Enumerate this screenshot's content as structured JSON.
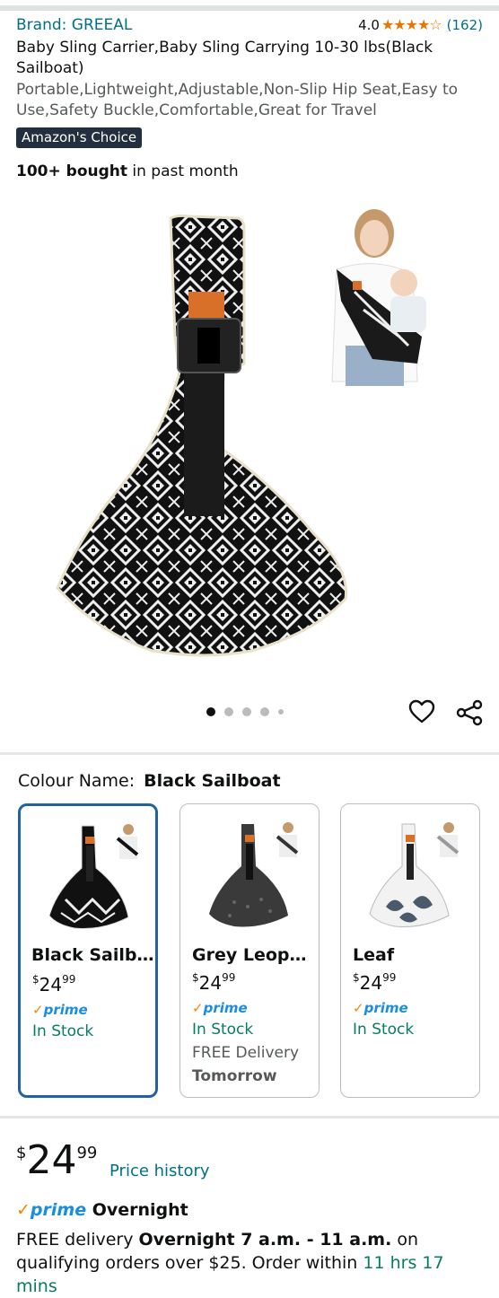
{
  "header": {
    "brand": "Brand: GREEAL",
    "rating_value": "4.0",
    "rating_stars": "★★★★☆",
    "rating_count": "(162)",
    "title": "Baby Sling Carrier,Baby Sling Carrying 10-30 lbs(Black Sailboat)",
    "subtitle": "Portable,Lightweight,Adjustable,Non-Slip Hip Seat,Easy to Use,Safety Buckle,Comfortable,Great for Travel",
    "badge": "Amazon's Choice",
    "bought_bold": "100+ bought",
    "bought_rest": " in past month"
  },
  "gallery": {
    "image_count": 5,
    "active_index": 0
  },
  "colour": {
    "label": "Colour Name:",
    "selected": "Black Sailboat",
    "options": [
      {
        "name": "Black Sailb…",
        "currency": "$",
        "whole": "24",
        "frac": "99",
        "prime": "prime",
        "stock": "In Stock",
        "delivery": "",
        "delivery_day": ""
      },
      {
        "name": "Grey Leop…",
        "currency": "$",
        "whole": "24",
        "frac": "99",
        "prime": "prime",
        "stock": "In Stock",
        "delivery": "FREE Delivery",
        "delivery_day": "Tomorrow"
      },
      {
        "name": "Leaf",
        "currency": "$",
        "whole": "24",
        "frac": "99",
        "prime": "prime",
        "stock": "In Stock",
        "delivery": "",
        "delivery_day": ""
      }
    ]
  },
  "buybox": {
    "currency": "$",
    "whole": "24",
    "frac": "99",
    "price_history": "Price history",
    "prime_label": "prime",
    "prime_suffix": " Overnight",
    "delivery_pre": "FREE delivery ",
    "delivery_window": "Overnight 7 a.m. - 11 a.m.",
    "delivery_mid": " on qualifying orders over $25. Order within ",
    "countdown": "11 hrs 17 mins"
  },
  "colors": {
    "link": "#007185",
    "prime_blue": "#1a8de0",
    "prime_check": "#f08804",
    "stock_green": "#067d62",
    "selected_border": "#2162a1"
  }
}
